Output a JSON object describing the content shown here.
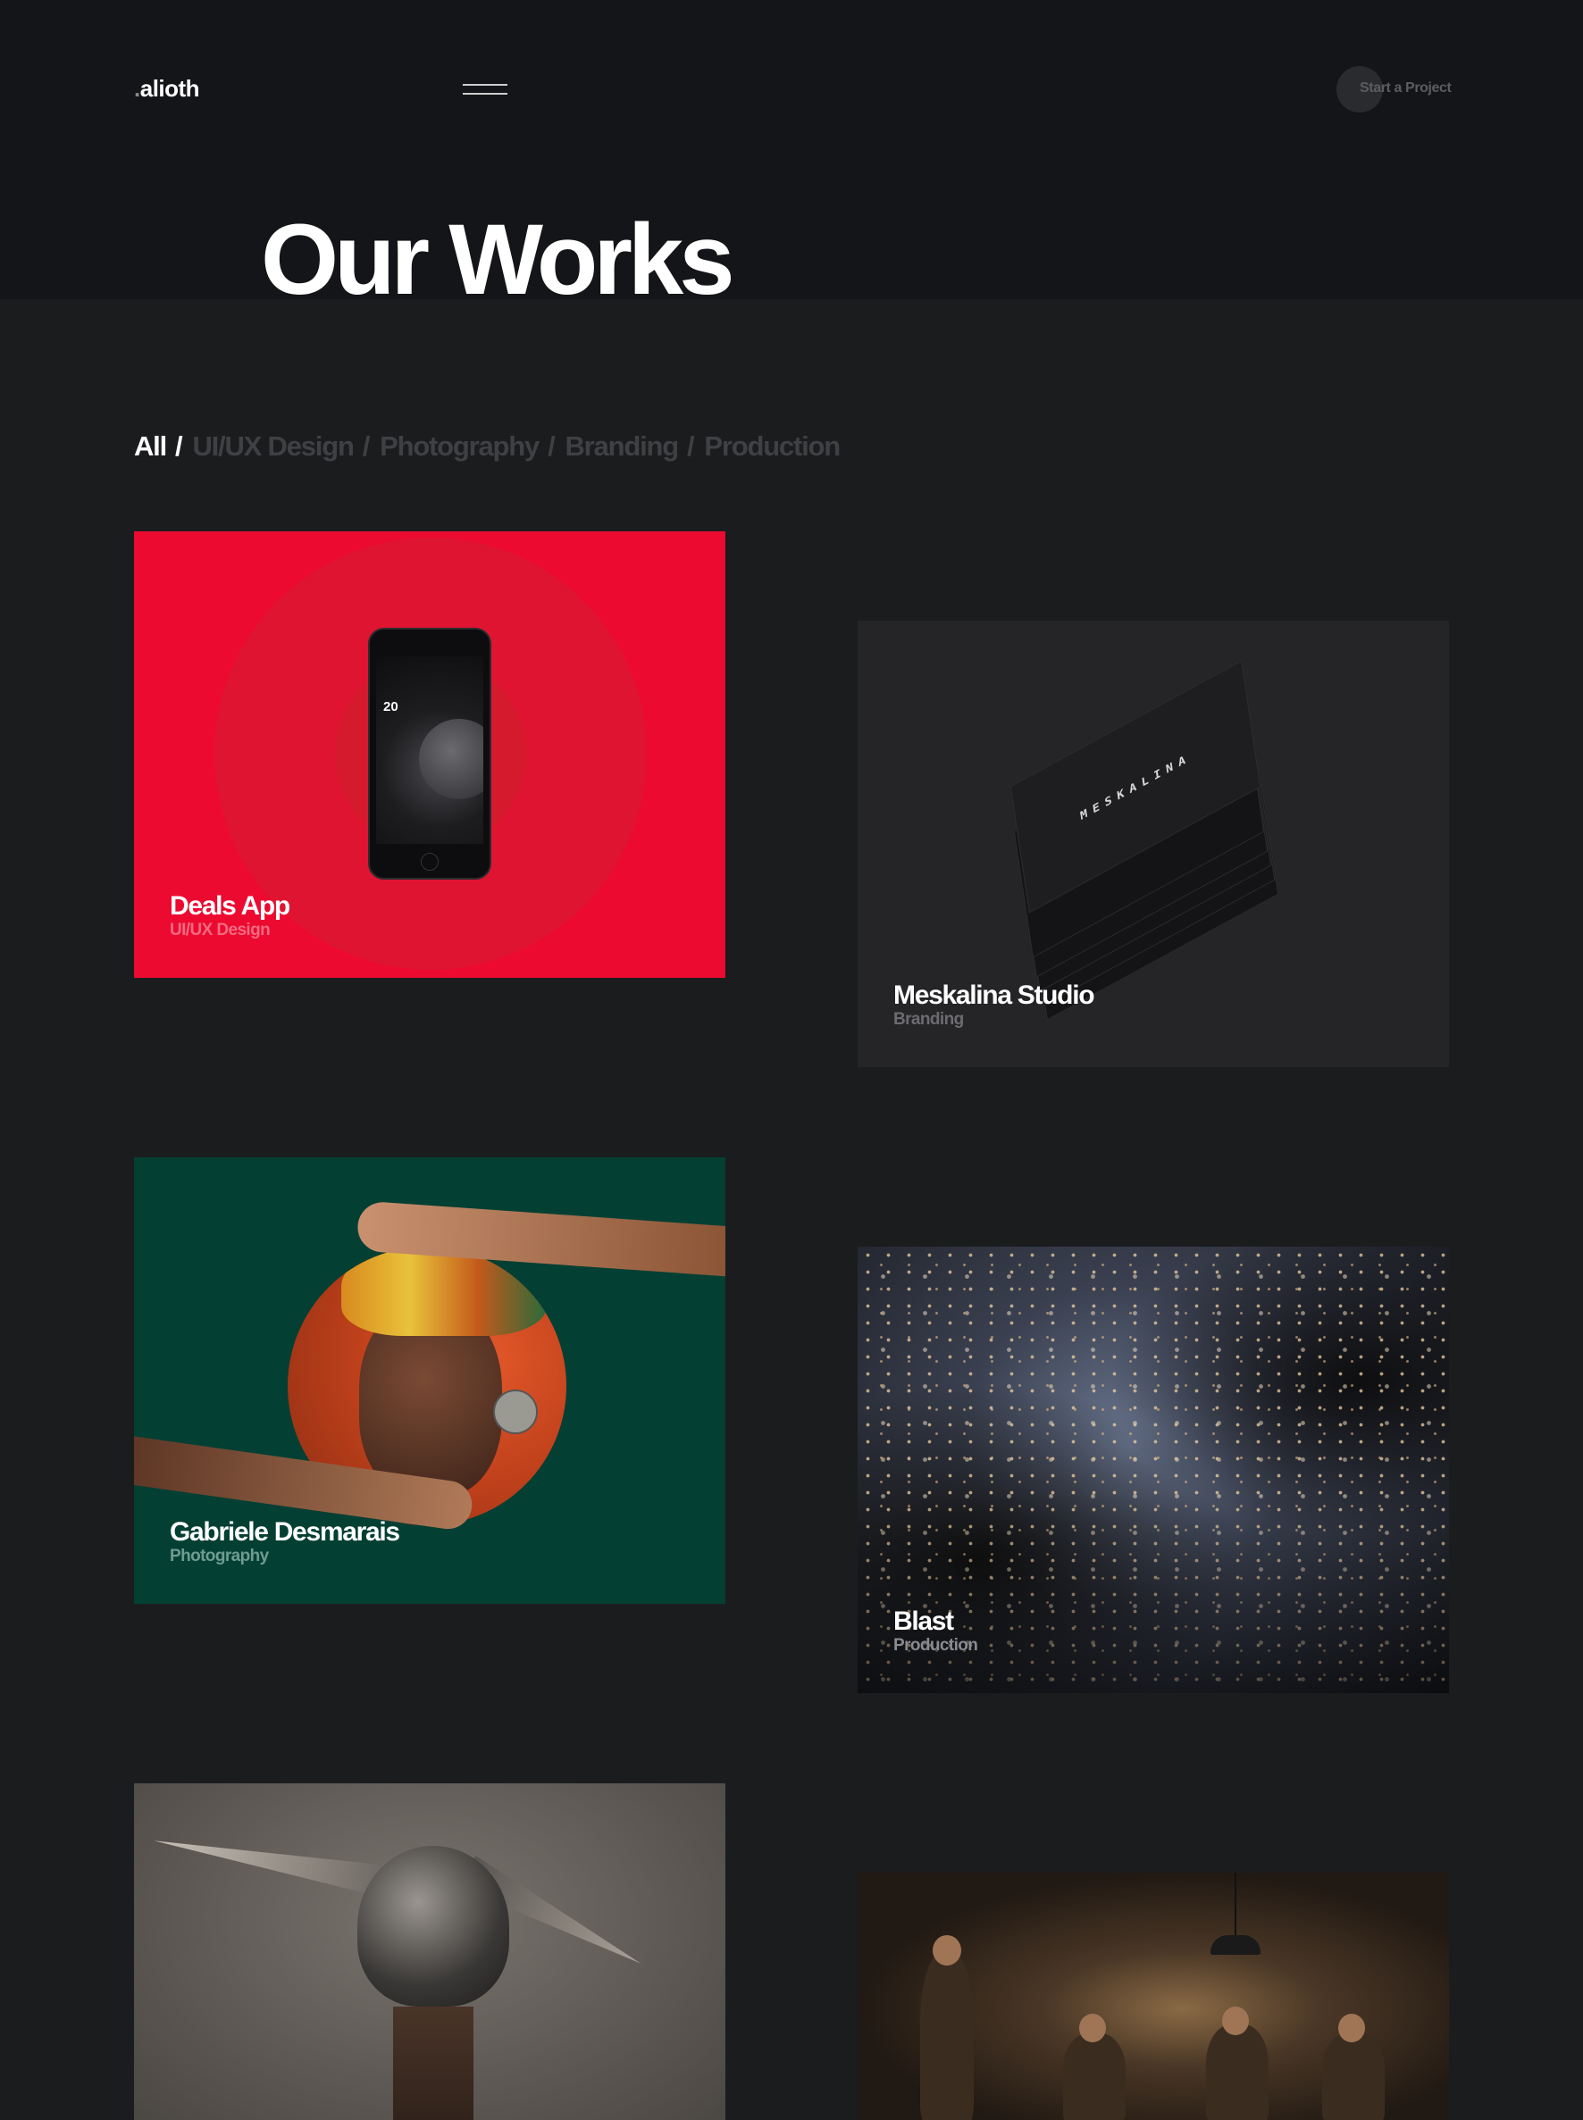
{
  "header": {
    "logo_dot": ".",
    "logo": "alioth",
    "cta_label": "Start a Project"
  },
  "page": {
    "title": "Our Works"
  },
  "filters": {
    "items": [
      "All",
      "UI/UX Design",
      "Photography",
      "Branding",
      "Production"
    ],
    "separator": "/",
    "active": "All"
  },
  "works": [
    {
      "title": "Deals App",
      "category": "UI/UX Design",
      "screen_number": "20"
    },
    {
      "title": "Meskalina Studio",
      "category": "Branding",
      "card_print": "MESKALINA"
    },
    {
      "title": "Gabriele Desmarais",
      "category": "Photography"
    },
    {
      "title": "Blast",
      "category": "Production"
    }
  ],
  "colors": {
    "background": "#1b1c1e",
    "deals_app": "#ec0a30",
    "meskalina": "#252527",
    "gabriele": "#043f33",
    "filter_inactive": "#3f4043"
  }
}
